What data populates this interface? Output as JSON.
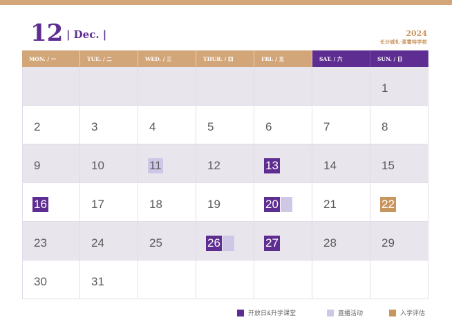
{
  "header": {
    "month_number": "12",
    "month_name": "| Dec. |",
    "year": "2024",
    "school": "长沙城礼·麦霍特学校"
  },
  "weekdays": [
    "MON. / 一",
    "TUE. / 二",
    "WED. / 三",
    "THUR. / 四",
    "FRI. / 五",
    "SAT. / 六",
    "SUN. / 日"
  ],
  "days": [
    "",
    "",
    "",
    "",
    "",
    "",
    "1",
    "2",
    "3",
    "4",
    "5",
    "6",
    "7",
    "8",
    "9",
    "10",
    "11",
    "12",
    "13",
    "14",
    "15",
    "16",
    "17",
    "18",
    "19",
    "20",
    "21",
    "22",
    "23",
    "24",
    "25",
    "26",
    "27",
    "28",
    "29",
    "30",
    "31",
    "",
    "",
    "",
    "",
    ""
  ],
  "marked_days": {
    "open_day": [
      "13",
      "16",
      "20",
      "26",
      "27"
    ],
    "live_event": [
      "11"
    ],
    "admission": [
      "22"
    ]
  },
  "legend": {
    "open_day": "开放日&升学课堂",
    "live_event": "直播活动",
    "admission": "入学评估"
  },
  "colors": {
    "purple": "#5e2d91",
    "tan": "#d3a679",
    "lavender": "#cfc7e6",
    "gold": "#c9955f"
  }
}
